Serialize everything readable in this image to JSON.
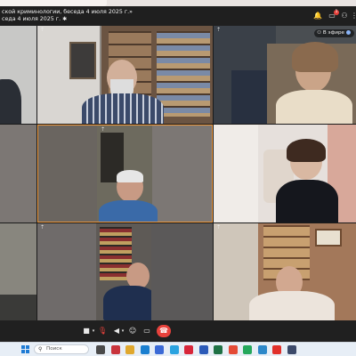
{
  "meeting": {
    "title": "ской криминологии, беседа 4 июля 2025 г.»",
    "subtitle": "седа 4 июля 2025 г.",
    "live_label": "В эфире",
    "header_icons": [
      {
        "name": "notifications-icon",
        "glyph": "🔔",
        "badge": ""
      },
      {
        "name": "chat-icon",
        "glyph": "▭",
        "badge": "1"
      },
      {
        "name": "participants-icon",
        "glyph": "👥",
        "badge": ""
      },
      {
        "name": "more-menu-icon",
        "glyph": "⋮",
        "badge": ""
      }
    ]
  },
  "controls": {
    "camera": "■",
    "camera_menu": "▾",
    "microphone": "🎙",
    "speaker": "◀",
    "speaker_menu": "▾",
    "reactions": "☺",
    "screen_share": "▭",
    "more": "•••",
    "end_call": "☎"
  },
  "taskbar": {
    "search_placeholder": "Поиск",
    "apps": [
      {
        "name": "task-view-icon",
        "color": "#4a4a4a"
      },
      {
        "name": "widgets-icon",
        "color": "#c9343c"
      },
      {
        "name": "explorer-icon",
        "color": "#e0a82e"
      },
      {
        "name": "edge-icon",
        "color": "#1a7fd0"
      },
      {
        "name": "store-icon",
        "color": "#3b6ad6"
      },
      {
        "name": "telegram-icon",
        "color": "#2aa3e0"
      },
      {
        "name": "opera-icon",
        "color": "#d8263a"
      },
      {
        "name": "word-icon",
        "color": "#2b5ab8"
      },
      {
        "name": "excel-icon",
        "color": "#1e7145"
      },
      {
        "name": "chrome-icon",
        "color": "#e44a36"
      },
      {
        "name": "whatsapp-icon",
        "color": "#25a85c"
      },
      {
        "name": "photos-icon",
        "color": "#2d88c9"
      },
      {
        "name": "yandex-icon",
        "color": "#e1302a"
      },
      {
        "name": "media-icon",
        "color": "#3c4a6a"
      }
    ]
  },
  "colors": {
    "end_call": "#e8423c",
    "active_speaker_border": "#f09a3e",
    "live_dot": "#8ab4f8"
  }
}
